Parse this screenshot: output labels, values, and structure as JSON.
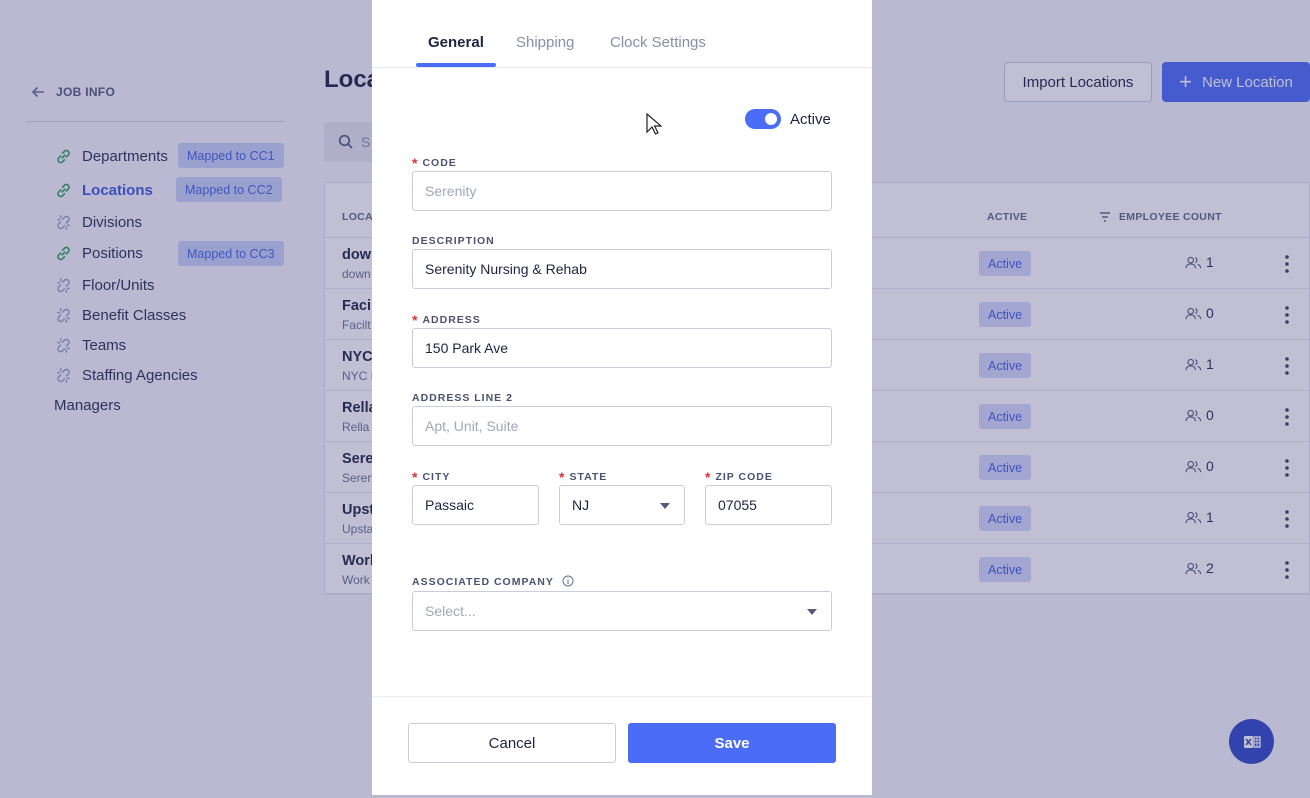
{
  "sidebar": {
    "back_label": "JOB INFO",
    "items": [
      {
        "label": "Departments",
        "icon": "link-icon",
        "linked": true,
        "badge": "Mapped to CC1"
      },
      {
        "label": "Locations",
        "icon": "link-icon",
        "linked": true,
        "badge": "Mapped to CC2",
        "active": true
      },
      {
        "label": "Divisions",
        "icon": "unlink-icon",
        "linked": false
      },
      {
        "label": "Positions",
        "icon": "link-icon",
        "linked": true,
        "badge": "Mapped to CC3"
      },
      {
        "label": "Floor/Units",
        "icon": "unlink-icon",
        "linked": false
      },
      {
        "label": "Benefit Classes",
        "icon": "unlink-icon",
        "linked": false
      },
      {
        "label": "Teams",
        "icon": "unlink-icon",
        "linked": false
      },
      {
        "label": "Staffing Agencies",
        "icon": "unlink-icon",
        "linked": false
      },
      {
        "label": "Managers"
      }
    ]
  },
  "header": {
    "title": "Loca",
    "search_placeholder": "S",
    "import_label": "Import Locations",
    "new_label": "New Location"
  },
  "table": {
    "columns": {
      "location": "LOCAT",
      "active": "ACTIVE",
      "employee_count": "EMPLOYEE COUNT"
    },
    "rows": [
      {
        "name": "dowr",
        "sub": "down",
        "status": "Active",
        "count": "1"
      },
      {
        "name": "Facil",
        "sub": "Facilt",
        "status": "Active",
        "count": "0"
      },
      {
        "name": "NYC",
        "sub": "NYC I",
        "status": "Active",
        "count": "1"
      },
      {
        "name": "Rella",
        "sub": "Rella",
        "status": "Active",
        "count": "0"
      },
      {
        "name": "Sere",
        "sub": "Seren",
        "status": "Active",
        "count": "0"
      },
      {
        "name": "Upst",
        "sub": "Upsta",
        "status": "Active",
        "count": "1"
      },
      {
        "name": "Work",
        "sub": "Work",
        "status": "Active",
        "count": "2"
      }
    ]
  },
  "modal": {
    "tabs": [
      {
        "label": "General",
        "active": true
      },
      {
        "label": "Shipping"
      },
      {
        "label": "Clock Settings"
      }
    ],
    "active_toggle": {
      "label": "Active",
      "on": true
    },
    "fields": {
      "code": {
        "label": "CODE",
        "required": true,
        "placeholder": "Serenity",
        "value": ""
      },
      "description": {
        "label": "DESCRIPTION",
        "value": "Serenity Nursing & Rehab"
      },
      "address": {
        "label": "ADDRESS",
        "required": true,
        "value": "150 Park Ave"
      },
      "address2": {
        "label": "ADDRESS LINE 2",
        "placeholder": "Apt, Unit, Suite",
        "value": ""
      },
      "city": {
        "label": "CITY",
        "required": true,
        "value": "Passaic"
      },
      "state": {
        "label": "STATE",
        "required": true,
        "value": "NJ"
      },
      "zip": {
        "label": "ZIP CODE",
        "required": true,
        "value": "07055"
      },
      "company": {
        "label": "ASSOCIATED COMPANY",
        "placeholder": "Select..."
      }
    },
    "cancel_label": "Cancel",
    "save_label": "Save"
  },
  "colors": {
    "accent": "#4a6cf7",
    "badge_bg": "#c9d3f6",
    "required": "#e0313e",
    "overlay": "#3a3778"
  }
}
